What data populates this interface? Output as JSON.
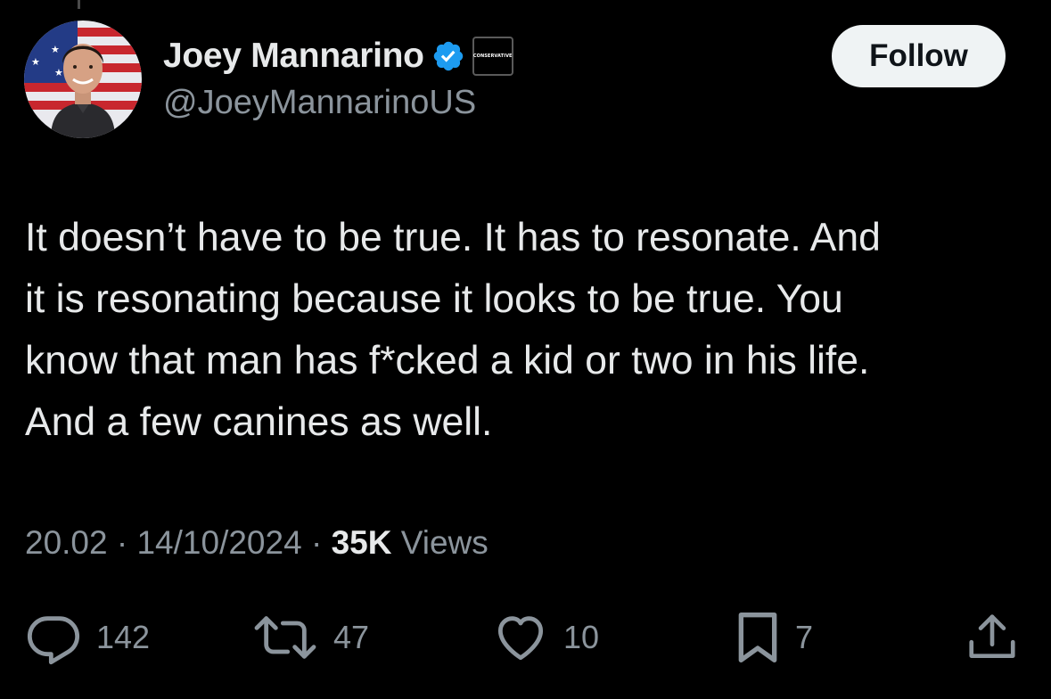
{
  "author": {
    "display_name": "Joey Mannarino",
    "handle": "@JoeyMannarinoUS",
    "verified": true,
    "affiliation_badge": "CONSERVATIVE",
    "avatar_icon": "profile-photo-flag-background"
  },
  "follow_button": {
    "label": "Follow"
  },
  "tweet": {
    "lines": [
      "It doesn’t have to be true. It has to resonate. And",
      "it is resonating because it looks to be true. You",
      "know that man has f*cked a kid or two in his life.",
      "And a few canines as well."
    ]
  },
  "meta": {
    "time": "20.02",
    "separator": "·",
    "date": "14/10/2024",
    "views_count": "35K",
    "views_label": "Views"
  },
  "actions": {
    "replies": {
      "icon": "reply-icon",
      "count": "142"
    },
    "reposts": {
      "icon": "repost-icon",
      "count": "47"
    },
    "likes": {
      "icon": "heart-icon",
      "count": "10"
    },
    "bookmarks": {
      "icon": "bookmark-icon",
      "count": "7"
    },
    "share": {
      "icon": "share-icon"
    }
  },
  "colors": {
    "background": "#000000",
    "primary_text": "#e7e9ea",
    "secondary_text": "#8b949c",
    "verified_blue": "#1d9bf0",
    "follow_button_bg": "#eff3f4"
  }
}
